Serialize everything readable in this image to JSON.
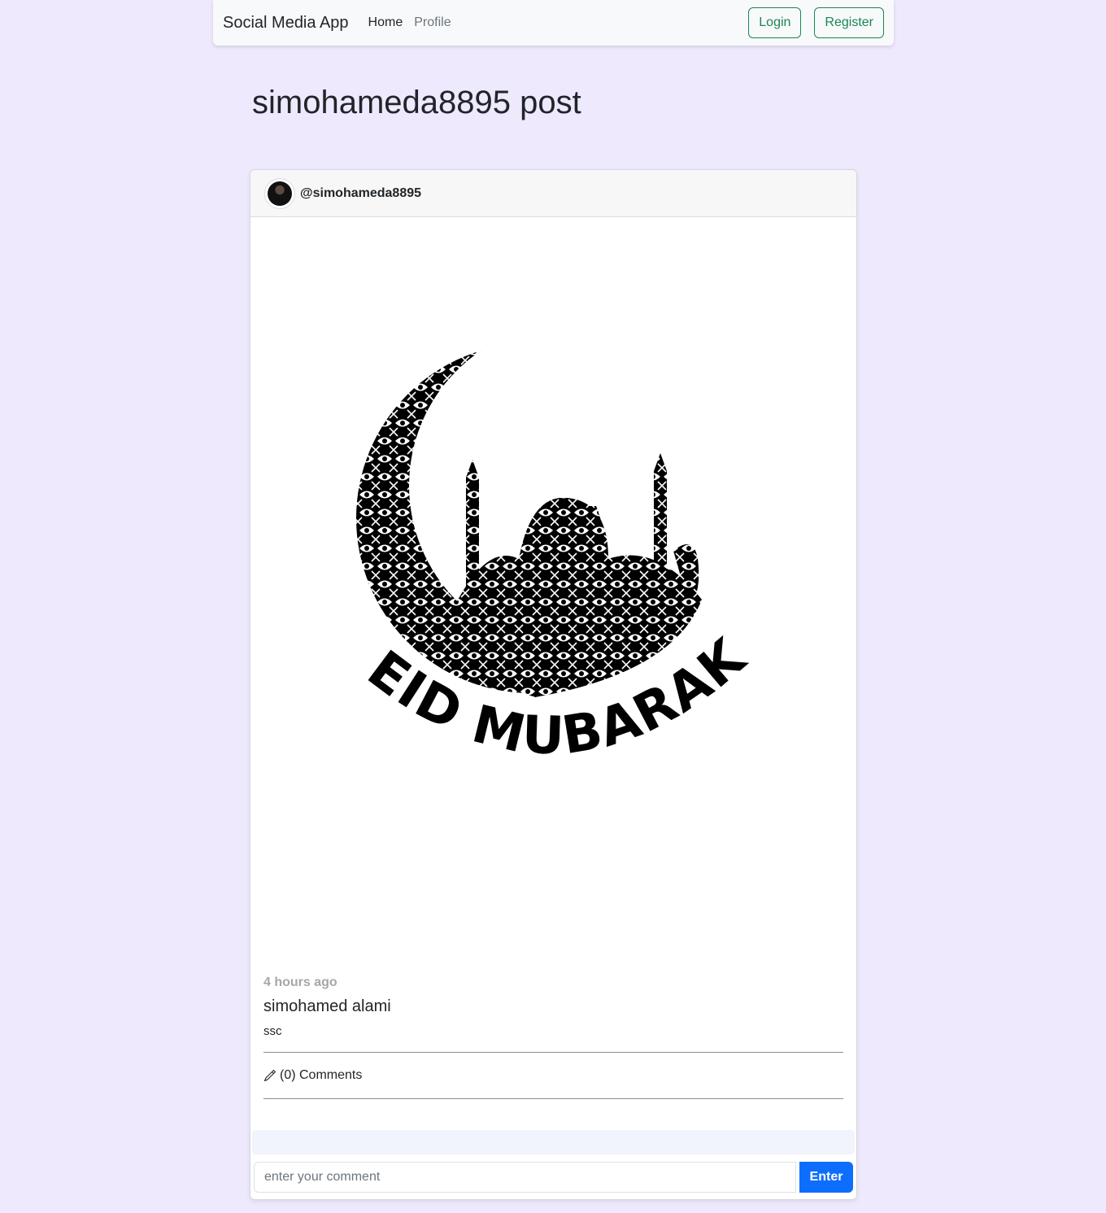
{
  "navbar": {
    "brand": "Social Media App",
    "links": [
      "Home",
      "Profile"
    ],
    "login_label": "Login",
    "register_label": "Register"
  },
  "page": {
    "title": "simohameda8895 post"
  },
  "post": {
    "username": "@simohameda8895",
    "image_text": "EID MUBARAK",
    "time": "4 hours ago",
    "author": "simohamed alami",
    "caption": "ssc",
    "comments_label": "(0) Comments"
  },
  "comment_form": {
    "placeholder": "enter your comment",
    "submit_label": "Enter"
  },
  "colors": {
    "background": "#eee9fd",
    "accent_green": "#198754",
    "primary_blue": "#0d6efd"
  }
}
